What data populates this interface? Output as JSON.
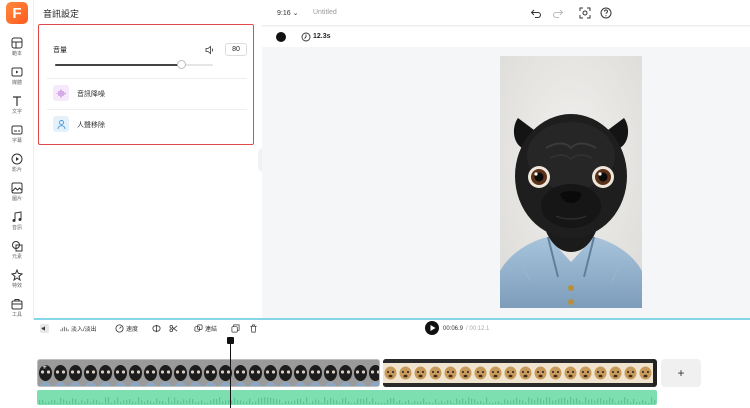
{
  "app": {
    "logo_letter": "F",
    "brand_color": "#ff6a2b"
  },
  "sidebar": {
    "items": [
      {
        "label": "範本",
        "icon": "template-icon"
      },
      {
        "label": "媒體",
        "icon": "media-icon"
      },
      {
        "label": "文字",
        "icon": "text-icon"
      },
      {
        "label": "字幕",
        "icon": "subtitle-icon"
      },
      {
        "label": "影片",
        "icon": "video-icon"
      },
      {
        "label": "圖片",
        "icon": "image-icon"
      },
      {
        "label": "音訊",
        "icon": "music-icon"
      },
      {
        "label": "元素",
        "icon": "elements-icon"
      },
      {
        "label": "特效",
        "icon": "effects-icon"
      },
      {
        "label": "工具",
        "icon": "tools-icon"
      }
    ]
  },
  "panel": {
    "title": "音訊設定",
    "volume": {
      "label": "音量",
      "value": "80",
      "level_percent": 80
    },
    "features": [
      {
        "label": "音訊降噪",
        "icon": "noise-reduction-icon"
      },
      {
        "label": "人聲移除",
        "icon": "vocal-remove-icon"
      }
    ]
  },
  "topbar": {
    "ratio": "9:16",
    "doc_title": "Untitled"
  },
  "subbar": {
    "duration": "12.3s"
  },
  "timeline": {
    "fade": "淡入/淡出",
    "speed": "速度",
    "link": "連結",
    "current_time": "00:06.9",
    "total_time": "/ 00:12.1",
    "add_label": "+"
  },
  "colors": {
    "selection_border": "#e04a4a",
    "timeline_accent": "#86d6e8",
    "audio_track": "#7ddeb0"
  }
}
